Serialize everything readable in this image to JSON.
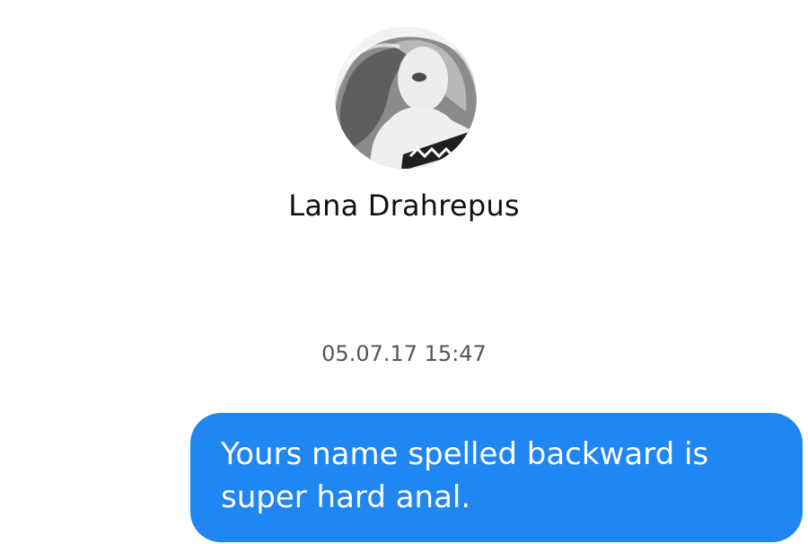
{
  "contact": {
    "name": "Lana Drahrepus",
    "avatar": "profile-photo"
  },
  "conversation": {
    "timestamp": "05.07.17 15:47",
    "messages": [
      {
        "direction": "outgoing",
        "text": "Yours name spelled backward is\nsuper hard anal.",
        "bubble_color": "#1f86f2"
      }
    ]
  },
  "colors": {
    "background": "#ffffff",
    "name_text": "#111111",
    "timestamp_text": "#555555",
    "message_text": "#ffffff"
  }
}
